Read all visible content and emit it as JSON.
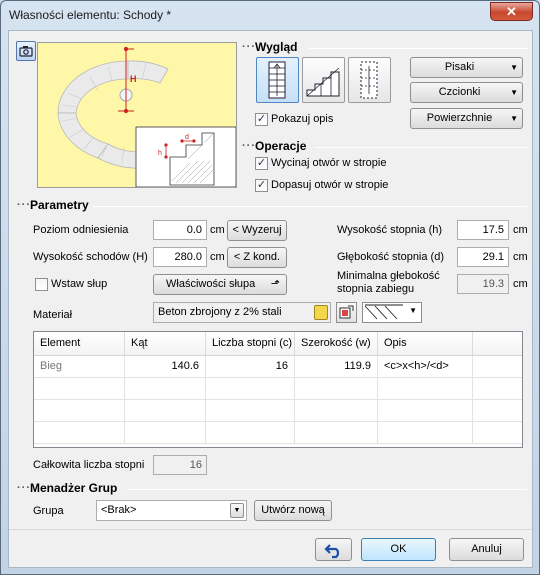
{
  "window": {
    "title": "Własności elementu: Schody *",
    "close": "✕"
  },
  "wyglad": {
    "header": "Wygląd",
    "pisaki": "Pisaki",
    "czcionki": "Czcionki",
    "powierzchnie": "Powierzchnie",
    "pokazuj_opis": "Pokazuj opis",
    "pokazuj_opis_checked": true
  },
  "operacje": {
    "header": "Operacje",
    "wycinaj": "Wycinaj otwór w stropie",
    "wycinaj_checked": true,
    "dopasuj": "Dopasuj otwór w stropie",
    "dopasuj_checked": true
  },
  "parametry": {
    "header": "Parametry",
    "poziom_label": "Poziom odniesienia",
    "poziom_value": "0.0",
    "wyzeruj": "< Wyzeruj",
    "wysokosc_schodow_label": "Wysokość schodów (H)",
    "wysokosc_schodow_value": "280.0",
    "z_kond": "< Z kond.",
    "wstaw_slup": "Wstaw słup",
    "wlasciwosci_slupa": "Właściwości słupa",
    "wysokosc_stopnia_label": "Wysokość stopnia (h)",
    "wysokosc_stopnia_value": "17.5",
    "glebokosc_stopnia_label": "Głębokość stopnia (d)",
    "glebokosc_stopnia_value": "29.1",
    "min_glebokosc_label1": "Minimalna głebokość",
    "min_glebokosc_label2": "stopnia zabiegu",
    "min_glebokosc_value": "19.3",
    "unit": "cm",
    "material_label": "Materiał",
    "material_value": "Beton zbrojony z 2% stali"
  },
  "table": {
    "headers": [
      "Element",
      "Kąt",
      "Liczba stopni (c)",
      "Szerokość (w)",
      "Opis"
    ],
    "rows": [
      [
        "Bieg",
        "140.6",
        "16",
        "119.9",
        "<c>x<h>/<d>"
      ]
    ]
  },
  "total": {
    "label": "Całkowita liczba stopni",
    "value": "16"
  },
  "grupy": {
    "header": "Menadżer Grup",
    "grupa_label": "Grupa",
    "grupa_value": "<Brak>",
    "utworz": "Utwórz nową"
  },
  "footer": {
    "ok": "OK",
    "anuluj": "Anuluj"
  },
  "preview_labels": {
    "H": "H",
    "h": "h",
    "d": "d"
  },
  "colors": {
    "preview_bg": "#fff7a8",
    "accent": "#cc2222"
  }
}
